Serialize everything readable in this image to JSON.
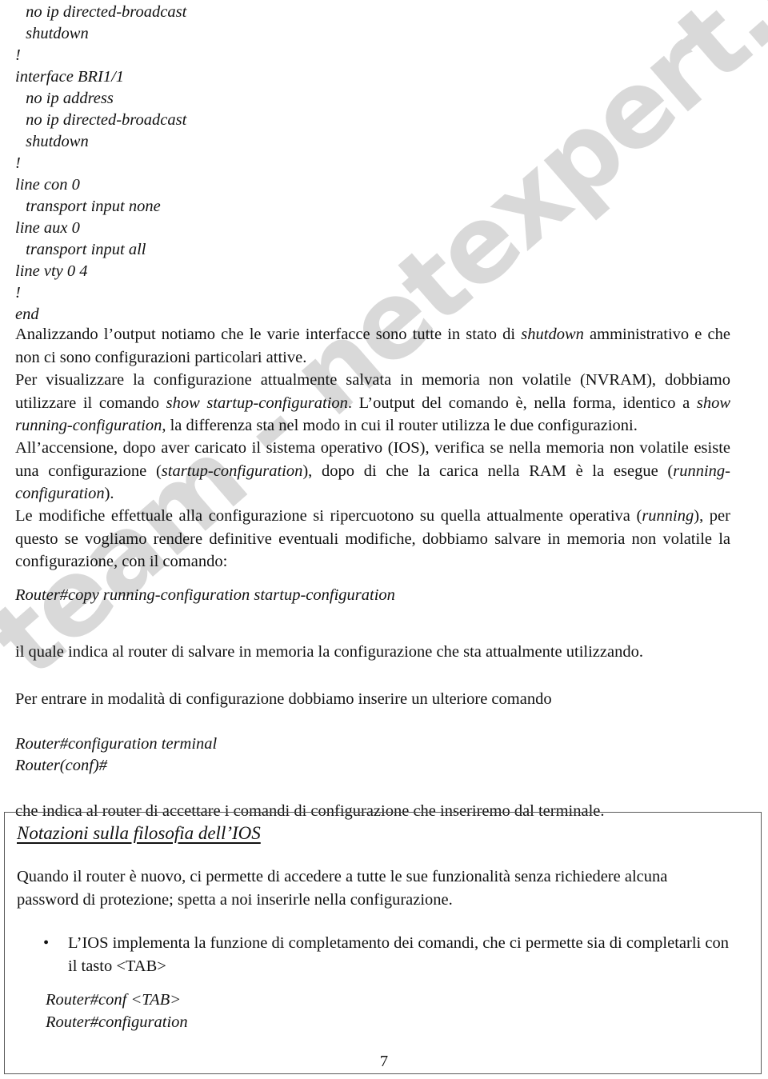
{
  "watermark": {
    "text": "team - netexpert.it",
    "color": "#d9d9d9"
  },
  "config_block": {
    "lines": [
      {
        "text": " no ip directed-broadcast",
        "indent": true
      },
      {
        "text": " shutdown",
        "indent": true
      },
      {
        "text": "!",
        "indent": false
      },
      {
        "text": "interface BRI1/1",
        "indent": false
      },
      {
        "text": " no ip address",
        "indent": true
      },
      {
        "text": " no ip directed-broadcast",
        "indent": true
      },
      {
        "text": " shutdown",
        "indent": true
      },
      {
        "text": "!",
        "indent": false
      },
      {
        "text": "line con 0",
        "indent": false
      },
      {
        "text": " transport input none",
        "indent": true
      },
      {
        "text": "line aux 0",
        "indent": false
      },
      {
        "text": " transport input all",
        "indent": true
      },
      {
        "text": "line vty 0 4",
        "indent": false
      },
      {
        "text": "!",
        "indent": false
      },
      {
        "text": "end",
        "indent": false
      }
    ]
  },
  "paragraphs": {
    "p1_a": "Analizzando l’output notiamo che le varie interfacce sono tutte in stato di ",
    "p1_em": "shutdown",
    "p1_b": " amministrativo e che non ci sono configurazioni particolari attive.",
    "p2_a": "Per visualizzare la configurazione attualmente salvata in memoria non volatile (NVRAM), dobbiamo utilizzare il comando ",
    "p2_em1": "show startup-configuration",
    "p2_b": ". L’output del comando è, nella forma, identico a ",
    "p2_em2": "show running-configuration",
    "p2_c": ", la differenza sta nel modo in cui il router utilizza le due configurazioni.",
    "p3_a": "All’accensione, dopo aver caricato il sistema operativo (IOS), verifica se nella memoria non volatile esiste una configurazione (",
    "p3_em1": "startup-configuration",
    "p3_b": "), dopo di che la carica nella RAM è la esegue (",
    "p3_em2": "running-configuration",
    "p3_c": ").",
    "p4_a": "Le modifiche effettuale alla configurazione si ripercuotono su quella attualmente operativa (",
    "p4_em": "running",
    "p4_b": "), per questo se vogliamo rendere definitive eventuali modifiche, dobbiamo salvare in memoria non volatile la configurazione, con il comando:",
    "p5": "il quale indica al router di salvare in memoria la configurazione che sta attualmente utilizzando.",
    "p6": "Per entrare in modalità di configurazione dobbiamo inserire un ulteriore comando",
    "p7": "che indica al router di accettare i comandi di configurazione che inseriremo dal terminale."
  },
  "commands": {
    "copy_cmd": "Router#copy running-configuration startup-configuration",
    "config_terminal": "Router#configuration terminal",
    "config_prompt": "Router(conf)#"
  },
  "note_box": {
    "heading": "Notazioni sulla filosofia dell’IOS",
    "paragraph": "Quando il router è nuovo, ci permette di accedere a tutte le sue funzionalità senza richiedere alcuna password di protezione; spetta a noi inserirle nella configurazione.",
    "bullet_marker": "•",
    "bullets": [
      "L’IOS implementa la funzione di completamento dei comandi, che ci permette sia di completarli con il tasto <TAB>"
    ],
    "commands": {
      "conf_tab": "Router#conf <TAB>",
      "configuration": "Router#configuration"
    }
  },
  "footer": {
    "page_number": "7"
  }
}
